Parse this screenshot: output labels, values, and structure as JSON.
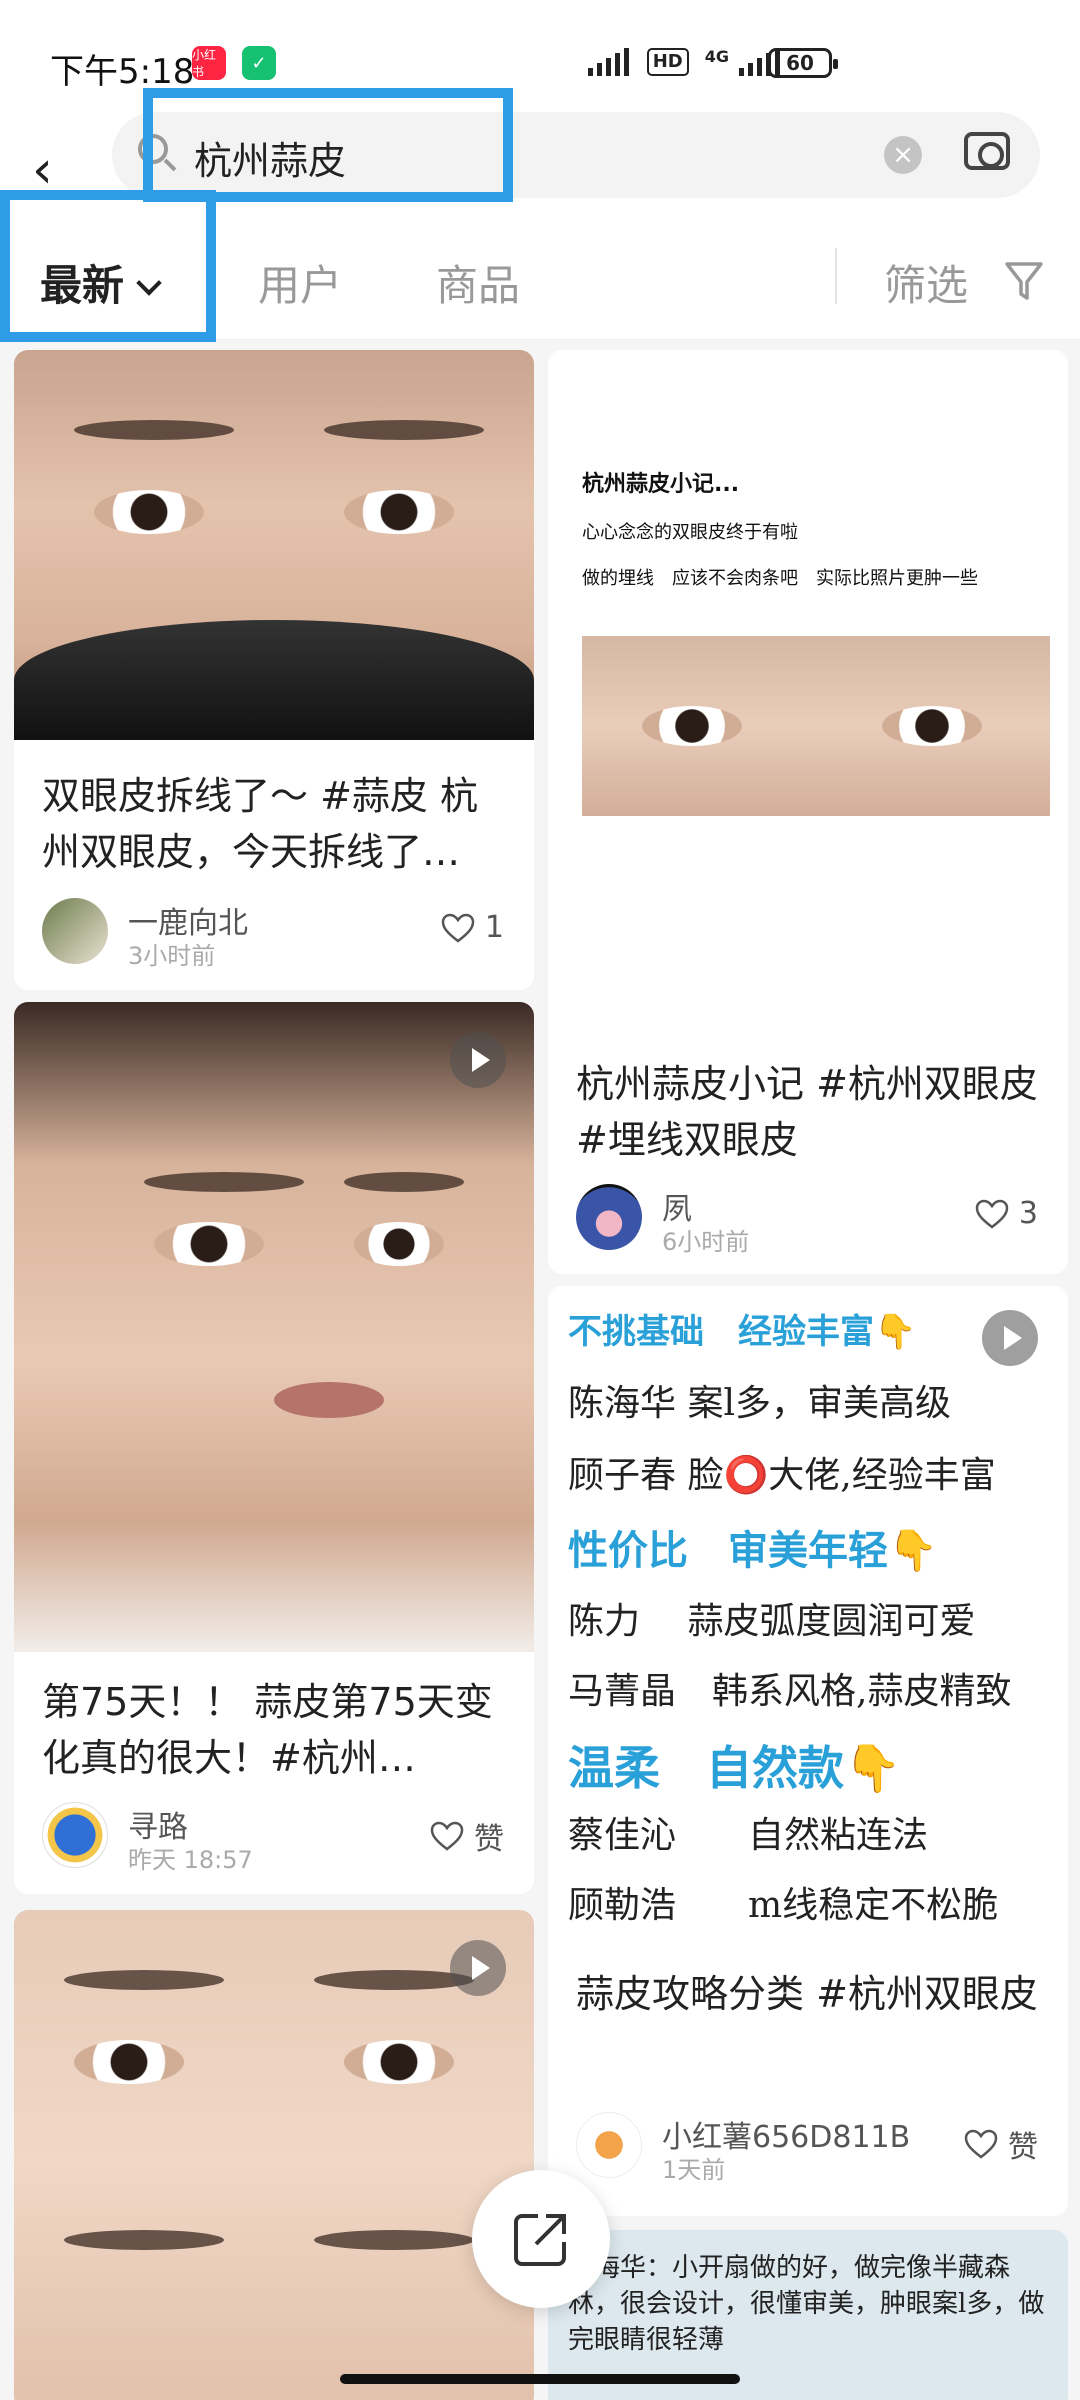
{
  "status_bar": {
    "time": "下午5:18",
    "app_badge": "小红书",
    "network": "4G",
    "battery": "60"
  },
  "search": {
    "query": "杭州蒜皮"
  },
  "tabs": {
    "latest": "最新",
    "users": "用户",
    "products": "商品",
    "filter": "筛选"
  },
  "feed": {
    "left": [
      {
        "title": "双眼皮拆线了～ #蒜皮 杭州双眼皮，今天拆线了…",
        "author": "一鹿向北",
        "time": "3小时前",
        "likes": "1",
        "video": false
      },
      {
        "title": "第75天！！ 蒜皮第75天变化真的很大！#杭州…",
        "author": "寻路",
        "time": "昨天 18:57",
        "likes": "赞",
        "video": true
      },
      {
        "title": "",
        "author": "",
        "time": "",
        "likes": "",
        "video": true
      }
    ],
    "right": [
      {
        "image_text": {
          "title": "杭州蒜皮小记...",
          "line1": "心心念念的双眼皮终于有啦",
          "line2": "做的埋线　应该不会肉条吧　实际比照片更肿一些"
        },
        "title": "杭州蒜皮小记 #杭州双眼皮 #埋线双眼皮",
        "author": "夙",
        "time": "6小时前",
        "likes": "3",
        "video": false
      },
      {
        "image_lines": [
          "不挑基础　经验丰富👇",
          "陈海华 案l多，审美高级",
          "顾子春 脸⭕大佬,经验丰富",
          "性价比　审美年轻👇",
          "陈力　 蒜皮弧度圆润可爱",
          "马菁晶　韩系风格,蒜皮精致",
          "温柔　自然款👇",
          "蔡佳沁　　自然粘连法",
          "顾勒浩　　m线稳定不松脆"
        ],
        "title": "蒜皮攻略分类 #杭州双眼皮",
        "author": "小红薯656D811B",
        "time": "1天前",
        "likes": "赞",
        "video": true
      },
      {
        "partial_text": "陈海华：小开扇做的好，做完像半藏森林，很会设计，很懂审美，肿眼案l多，做完眼睛很轻薄"
      }
    ]
  },
  "colors": {
    "highlight": "#2f9ce8",
    "brand": "#ff2442"
  }
}
